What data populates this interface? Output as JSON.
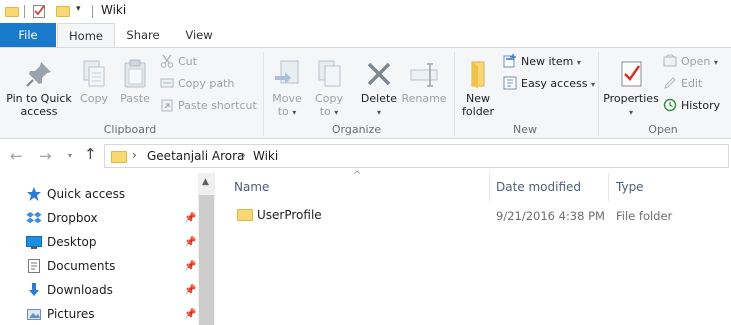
{
  "titlebar": {
    "title": "Wiki",
    "icons": [
      "folder-icon",
      "properties-check-icon",
      "new-folder-icon",
      "qat-dropdown-icon"
    ]
  },
  "ribbon_tabs": {
    "file": "File",
    "home": "Home",
    "share": "Share",
    "view": "View"
  },
  "clipboard": {
    "pin_to_quick_access_line1": "Pin to Quick",
    "pin_to_quick_access_line2": "access",
    "copy": "Copy",
    "paste": "Paste",
    "cut": "Cut",
    "copy_path": "Copy path",
    "paste_shortcut": "Paste shortcut",
    "group_label": "Clipboard"
  },
  "organize": {
    "move_to_line1": "Move",
    "move_to_line2": "to",
    "copy_to_line1": "Copy",
    "copy_to_line2": "to",
    "delete": "Delete",
    "rename": "Rename",
    "group_label": "Organize"
  },
  "new_group": {
    "new_folder_line1": "New",
    "new_folder_line2": "folder",
    "new_item": "New item",
    "easy_access": "Easy access",
    "group_label": "New"
  },
  "open_group": {
    "properties": "Properties",
    "open": "Open",
    "edit": "Edit",
    "history": "History",
    "group_label": "Open"
  },
  "address": {
    "crumbs": [
      "Geetanjali Arora",
      "Wiki"
    ]
  },
  "nav_pane": {
    "items": [
      {
        "label": "Quick access",
        "icon": "star-icon",
        "pinned": false
      },
      {
        "label": "Dropbox",
        "icon": "dropbox-icon",
        "pinned": true
      },
      {
        "label": "Desktop",
        "icon": "desktop-icon",
        "pinned": true
      },
      {
        "label": "Documents",
        "icon": "documents-icon",
        "pinned": true
      },
      {
        "label": "Downloads",
        "icon": "downloads-icon",
        "pinned": true
      },
      {
        "label": "Pictures",
        "icon": "pictures-icon",
        "pinned": true
      }
    ]
  },
  "file_list": {
    "columns": {
      "name": "Name",
      "date_modified": "Date modified",
      "type": "Type"
    },
    "rows": [
      {
        "name": "UserProfile",
        "date_modified": "9/21/2016 4:38 PM",
        "type": "File folder"
      }
    ]
  },
  "colors": {
    "file_tab": "#1979ca",
    "folder": "#f8d775",
    "column_header_text": "#4c607a"
  }
}
